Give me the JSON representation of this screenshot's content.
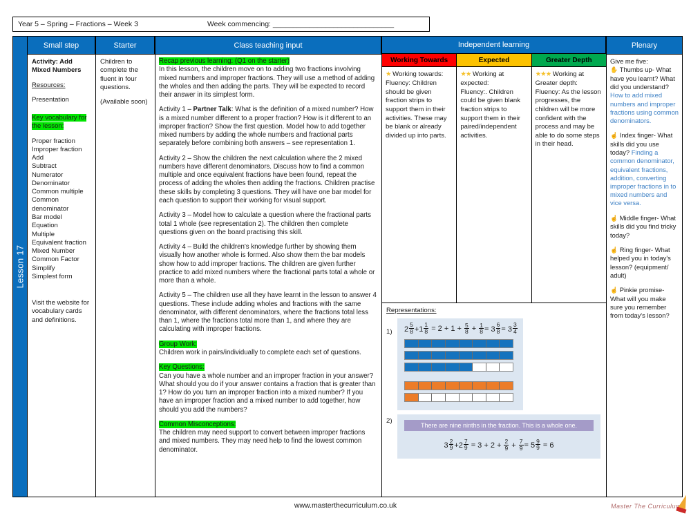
{
  "header": {
    "left": "Year 5 – Spring – Fractions – Week 3",
    "right": "Week commencing: ______________________________"
  },
  "spine": {
    "label": "Lesson 17"
  },
  "columns": {
    "small_step": "Small step",
    "starter": "Starter",
    "teaching": "Class teaching input",
    "independent": "Independent learning",
    "plenary": "Plenary"
  },
  "small_step": {
    "activity_title": "Activity: Add Mixed Numbers",
    "resources_label": "Resources:",
    "presentation": "Presentation",
    "vocab_heading": "Key vocabulary for the lesson:",
    "vocab": [
      "Proper fraction",
      "Improper fraction",
      "Add",
      "Subtract",
      "Numerator",
      "Denominator",
      "Common multiple",
      "Common denominator",
      "Bar model",
      "Equation",
      "Multiple",
      "Equivalent fraction",
      "Mixed Number",
      "Common Factor",
      "Simplify",
      "Simplest form"
    ],
    "visit_note": "Visit the website for vocabulary cards and definitions."
  },
  "starter": {
    "line1": "Children to complete the fluent in four questions.",
    "line2": "(Available soon)"
  },
  "teaching": {
    "recap_heading": "Recap previous learning: (Q1 on the starter)",
    "recap_text": "In this lesson, the children move on to adding two fractions involving mixed numbers and improper fractions. They will use a method of adding the wholes and then adding the parts. They will be expected to record their answer in its simplest form.",
    "activity1_prefix": "Activity 1 – ",
    "activity1_bold": "Partner Talk",
    "activity1_text": ": What is the definition of a mixed number? How is a mixed number different to a proper fraction? How is it different to an improper fraction?  Show the first question. Model how to add together mixed numbers by adding the whole numbers and fractional parts separately before combining both answers – see representation 1.",
    "activity2": "Activity 2 – Show the children the next calculation where the 2 mixed numbers have different denominators. Discuss how to find a common multiple and once equivalent fractions have been found, repeat the process of adding the wholes then adding the fractions. Children practise these skills by completing 3 questions. They will have one bar model for each question to support their working for visual support.",
    "activity3": "Activity 3 – Model how to calculate a question where the fractional parts total 1 whole (see representation 2). The children then complete questions given on the board practising this skill.",
    "activity4": "Activity 4 – Build the children's knowledge further by showing them visually how another whole is formed. Also show them the bar models show how to add improper fractions. The children are given further practice to add mixed numbers where the fractional parts total a whole or more than a whole.",
    "activity5": "Activity 5 – The children use all they have learnt in the lesson to answer 4 questions. These include adding wholes and fractions with the same denominator, with different denominators, where the fractions total less than 1, where the fractions total more than 1, and where they are calculating with improper fractions.",
    "group_work_heading": "Group Work:",
    "group_work_text": "Children work in pairs/individually to complete each set of questions.",
    "key_questions_heading": "Key Questions:",
    "key_questions_text": "Can you have a whole number and an improper fraction in your answer? What should you do if your answer contains a fraction that is greater than 1? How do you turn an improper fraction into a mixed number? If you have an improper fraction and a mixed number to add together, how should you add the numbers?",
    "misconceptions_heading": "Common Misconceptions:",
    "misconceptions_text": "The children may need support to convert between improper fractions and mixed numbers. They may need help to find the lowest common denominator."
  },
  "independent": {
    "working_towards": {
      "header": "Working Towards",
      "stars": "★",
      "title": "Working towards:",
      "text": "Fluency: Children should be given fraction strips to support them in their activities. These may be blank or already divided up into parts."
    },
    "expected": {
      "header": "Expected",
      "stars": "★★",
      "title": "Working at expected:",
      "text": "Fluency:. Children could be given blank fraction strips to support them in their paired/independent activities."
    },
    "greater_depth": {
      "header": "Greater Depth",
      "stars": "★★★",
      "title": "Working at Greater depth:",
      "text": "Fluency: As the lesson progresses, the children will be more confident with the process and may be able to do some steps in their head."
    },
    "representations_heading": "Representations:",
    "rep1": {
      "number": "1)",
      "equation_parts": [
        "2",
        "5",
        "8",
        "+1",
        "1",
        "8",
        " = 2 + 1 + ",
        "5",
        "8",
        " + ",
        "1",
        "8",
        " = 3",
        "6",
        "8",
        " = 3",
        "3",
        "4"
      ],
      "bars": [
        {
          "color": "blue",
          "total": 8,
          "filled": 8
        },
        {
          "color": "blue",
          "total": 8,
          "filled": 8
        },
        {
          "color": "blue",
          "total": 8,
          "filled": 5
        },
        {
          "color": "orange",
          "total": 8,
          "filled": 8
        },
        {
          "color": "orange",
          "total": 8,
          "filled": 1
        }
      ]
    },
    "rep2": {
      "number": "2)",
      "callout": "There are nine ninths in the fraction. This is a whole one.",
      "equation_parts": [
        "3",
        "2",
        "9",
        "+2",
        "7",
        "9",
        " = 3 + 2 + ",
        "2",
        "9",
        " + ",
        "7",
        "9",
        " = 5",
        "9",
        "9",
        " = 6"
      ]
    }
  },
  "plenary": {
    "intro": "Give me five:",
    "items": [
      {
        "hand": "✋",
        "question": "Thumbs up- What have you learnt? What did you understand?",
        "answer": "How to add mixed numbers and improper fractions using common denominators."
      },
      {
        "hand": "☝",
        "question": "Index finger- What skills did you use today?",
        "answer": "Finding a common denominator, equivalent fractions, addition, converting improper fractions in to mixed numbers and vice versa."
      },
      {
        "hand": "☝",
        "question": "Middle finger- What skills did you find tricky today?",
        "answer": ""
      },
      {
        "hand": "☝",
        "question": "Ring finger- What helped you in today's lesson? (equipment/ adult)",
        "answer": ""
      },
      {
        "hand": "☝",
        "question": "Pinkie promise- What will you make sure you remember from today's lesson?",
        "answer": ""
      }
    ]
  },
  "footer": {
    "website": "www.masterthecurriculum.co.uk",
    "brand": "Master The Curriculum"
  },
  "colors": {
    "header_blue": "#0a6ebd",
    "working_towards": "#ff0000",
    "expected": "#fcc200",
    "greater_depth": "#00a94f",
    "highlight_green": "#00e500",
    "bar_blue": "#1573be",
    "bar_orange": "#ec7c28",
    "callout_purple": "#a49bc8",
    "answer_blue": "#3b7fc4"
  }
}
